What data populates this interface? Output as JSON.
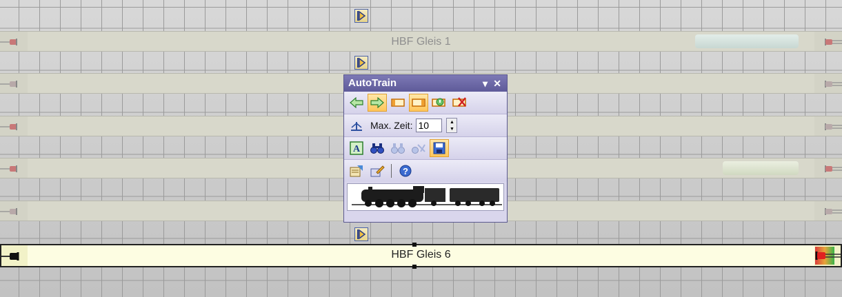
{
  "tracks": [
    {
      "label": "HBF Gleis 1"
    },
    {
      "label": ""
    },
    {
      "label": ""
    },
    {
      "label": ""
    },
    {
      "label": ""
    },
    {
      "label": "HBF Gleis 6"
    }
  ],
  "panel": {
    "title": "AutoTrain",
    "dropdown_icon": "▾",
    "close_icon": "✕",
    "max_time_label": "Max. Zeit:",
    "max_time_value": "10",
    "image_alt": "locomotive-image"
  },
  "colors": {
    "panel_title_bg": "#6562a3",
    "active_track_bg": "#fdfde2",
    "highlight_button": "#ffc65a",
    "signal_red": "#d93b3b",
    "signal_green": "#39b54a"
  }
}
